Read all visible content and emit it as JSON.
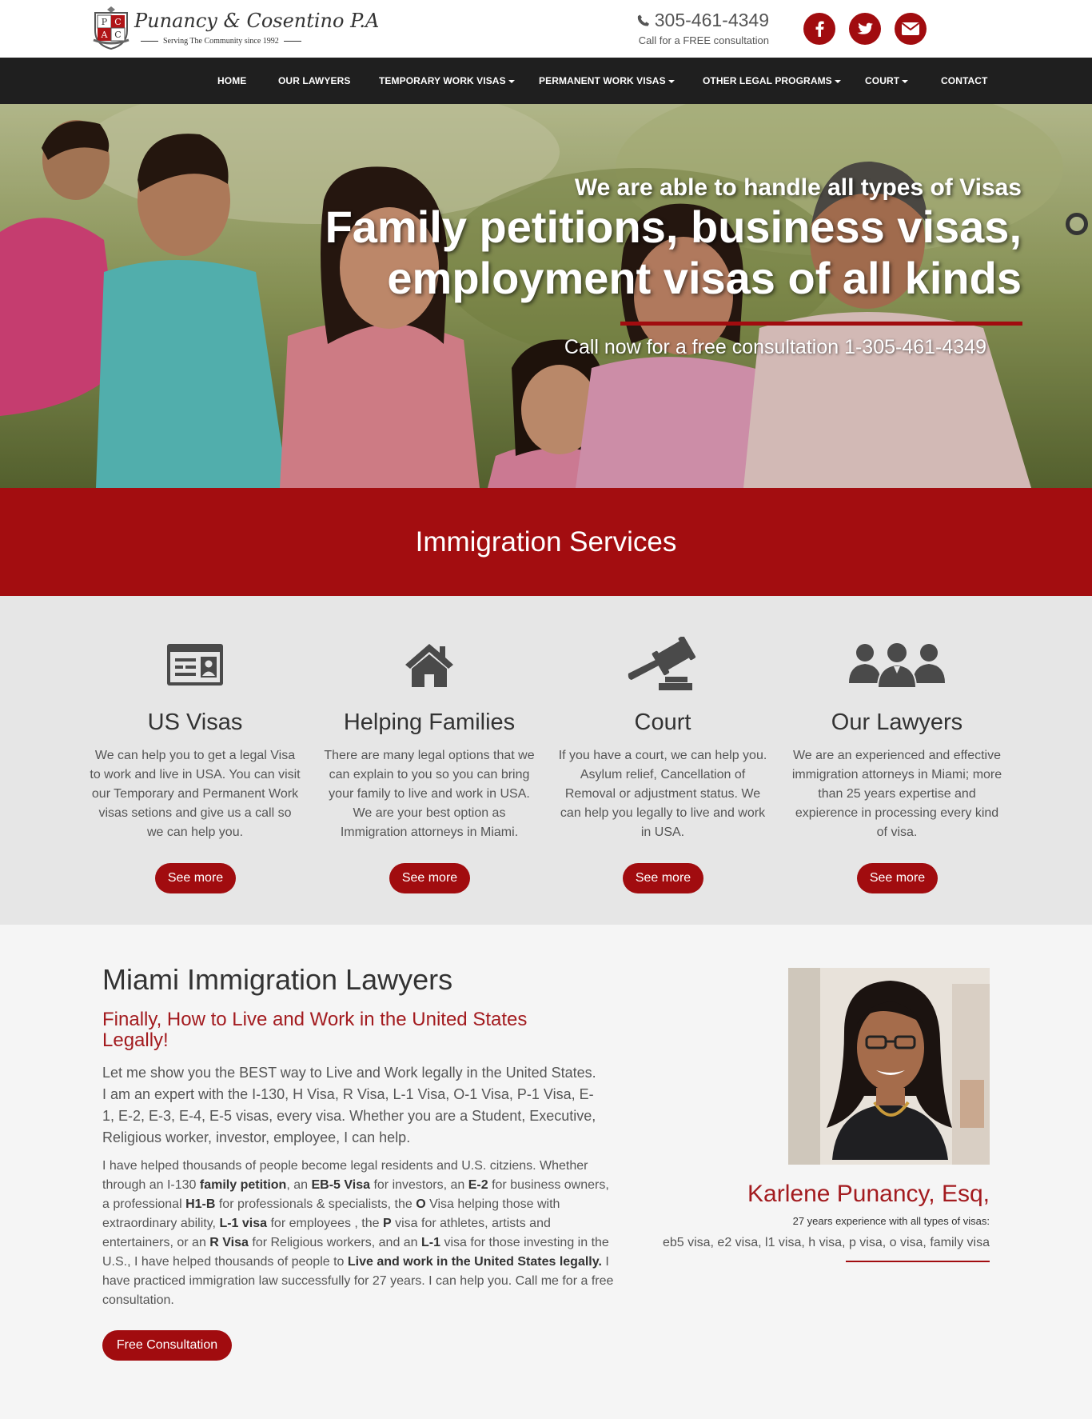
{
  "brand": {
    "name": "Punancy & Cosentino P.A",
    "tagline": "Serving The Community since 1992",
    "crest_letters": [
      "P",
      "C",
      "A",
      "C"
    ],
    "accent_color": "#a10c0f"
  },
  "contact": {
    "phone": "305-461-4349",
    "phone_caption": "Call for a FREE consultation",
    "social": [
      "facebook-icon",
      "twitter-icon",
      "envelope-icon"
    ]
  },
  "nav": {
    "items": [
      {
        "label": "HOME"
      },
      {
        "label": "OUR LAWYERS"
      },
      {
        "label": "TEMPORARY WORK VISAS"
      },
      {
        "label": "PERMANENT WORK VISAS"
      },
      {
        "label": "OTHER LEGAL PROGRAMS"
      },
      {
        "label": "COURT"
      },
      {
        "label": "CONTACT"
      }
    ]
  },
  "hero": {
    "kicker": "We are able to handle all types of Visas",
    "title": "Family petitions, business visas, employment visas of all kinds",
    "cta": "Call now for a free consultation 1-305-461-4349"
  },
  "services": {
    "heading": "Immigration Services",
    "items": [
      {
        "icon": "id-card-icon",
        "title": "US Visas",
        "text": "We can help you to get a legal Visa to work and live in USA. You can visit our Temporary and Permanent Work visas setions and give us a call so we can help you.",
        "button": "See more"
      },
      {
        "icon": "home-icon",
        "title": "Helping Families",
        "text": "There are many legal options that we can explain to you so you can bring your family to live and work in USA. We are your best option as Immigration attorneys in Miami.",
        "button": "See more"
      },
      {
        "icon": "gavel-icon",
        "title": "Court",
        "text": "If you have a court, we can help you. Asylum relief, Cancellation of Removal or adjustment status. We can help you legally to live and work in USA.",
        "button": "See more"
      },
      {
        "icon": "users-icon",
        "title": "Our Lawyers",
        "text": "We are an experienced and effective immigration attorneys in Miami; more than 25 years expertise and expierence in processing every kind of visa.",
        "button": "See more"
      }
    ]
  },
  "about": {
    "heading": "Miami Immigration Lawyers",
    "subheading": "Finally, How to Live and Work in the United States Legally!",
    "lead": "Let me show you the BEST way to Live and Work legally in the United States. I am an expert with the I-130, H Visa, R Visa, L-1 Visa, O-1 Visa, P-1 Visa, E-1, E-2, E-3, E-4, E-5 visas, every visa. Whether you are a Student, Executive, Religious worker, investor, employee, I can help.",
    "body": [
      {
        "t": "I have helped thousands of people become legal residents and U.S. citziens. Whether through an I-130 "
      },
      {
        "t": "family petition",
        "b": true
      },
      {
        "t": ", an "
      },
      {
        "t": "EB-5 Visa",
        "b": true
      },
      {
        "t": " for investors, an "
      },
      {
        "t": "E-2",
        "b": true
      },
      {
        "t": " for business owners, a professional "
      },
      {
        "t": "H1-B",
        "b": true
      },
      {
        "t": " for professionals & specialists, the "
      },
      {
        "t": "O",
        "b": true
      },
      {
        "t": " Visa helping those with extraordinary ability, "
      },
      {
        "t": "L-1 visa",
        "b": true
      },
      {
        "t": " for employees , the "
      },
      {
        "t": "P",
        "b": true
      },
      {
        "t": " visa for athletes, artists and entertainers, or an "
      },
      {
        "t": "R Visa",
        "b": true
      },
      {
        "t": " for Religious workers, and an "
      },
      {
        "t": "L-1",
        "b": true
      },
      {
        "t": " visa for those investing in the U.S., I have helped thousands of people to "
      },
      {
        "t": "Live and work in the United States legally.",
        "b": true
      },
      {
        "t": " I have practiced immigration law successfully for 27 years. I can help you. Call me for a free consultation."
      }
    ],
    "button": "Free Consultation",
    "lawyer": {
      "name": "Karlene Punancy, Esq,",
      "experience": "27 years experience with all types of visas:",
      "visas": "eb5 visa, e2 visa, l1 visa, h visa, p visa, o visa, family visa"
    }
  }
}
